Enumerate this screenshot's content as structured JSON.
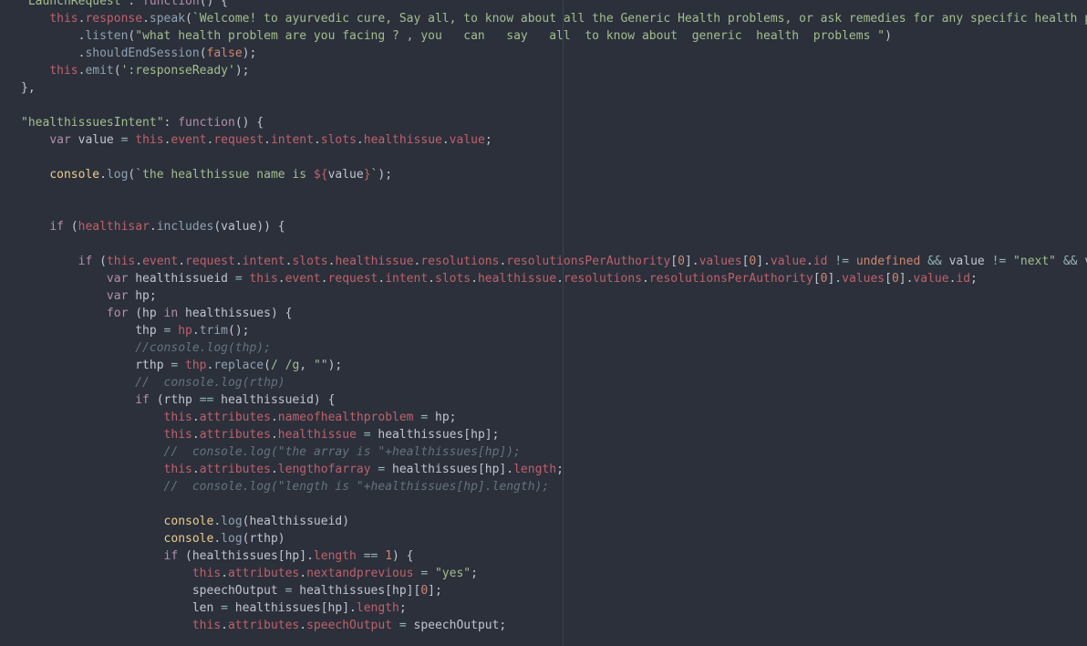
{
  "colors": {
    "background": "#2b303b",
    "plain": "#c0c5ce",
    "keyword": "#b48ead",
    "this": "#bf616a",
    "function": "#8fa1b3",
    "string": "#a3be8c",
    "number": "#d08770",
    "comment": "#65737e",
    "object": "#ebcb8b",
    "operator": "#96b5b4"
  },
  "code_lines": [
    [
      [
        "st",
        "\"LaunchRequest\""
      ],
      [
        "pl",
        ": "
      ],
      [
        "kw",
        "function"
      ],
      [
        "pl",
        "() {"
      ]
    ],
    [
      [
        "pl",
        "    "
      ],
      [
        "th",
        "this"
      ],
      [
        "pl",
        "."
      ],
      [
        "th",
        "response"
      ],
      [
        "pl",
        "."
      ],
      [
        "fn",
        "speak"
      ],
      [
        "pl",
        "("
      ],
      [
        "st",
        "`Welcome! to ayurvedic cure, Say all, to know about all the Generic Health problems, or ask remedies for any specific health p"
      ]
    ],
    [
      [
        "pl",
        "        ."
      ],
      [
        "fn",
        "listen"
      ],
      [
        "pl",
        "("
      ],
      [
        "st",
        "\"what health problem are you facing ? , you   can   say   all  to know about  generic  health  problems \""
      ],
      [
        "pl",
        ")"
      ]
    ],
    [
      [
        "pl",
        "        ."
      ],
      [
        "fn",
        "shouldEndSession"
      ],
      [
        "pl",
        "("
      ],
      [
        "nm",
        "false"
      ],
      [
        "pl",
        ");"
      ]
    ],
    [
      [
        "pl",
        "    "
      ],
      [
        "th",
        "this"
      ],
      [
        "pl",
        "."
      ],
      [
        "fn",
        "emit"
      ],
      [
        "pl",
        "("
      ],
      [
        "st",
        "':responseReady'"
      ],
      [
        "pl",
        ");"
      ]
    ],
    [
      [
        "pl",
        "},"
      ]
    ],
    [],
    [
      [
        "st",
        "\"healthissuesIntent\""
      ],
      [
        "pl",
        ": "
      ],
      [
        "kw",
        "function"
      ],
      [
        "pl",
        "() {"
      ]
    ],
    [
      [
        "pl",
        "    "
      ],
      [
        "kw",
        "var"
      ],
      [
        "pl",
        " value "
      ],
      [
        "op",
        "="
      ],
      [
        "pl",
        " "
      ],
      [
        "th",
        "this"
      ],
      [
        "pl",
        "."
      ],
      [
        "th",
        "event"
      ],
      [
        "pl",
        "."
      ],
      [
        "th",
        "request"
      ],
      [
        "pl",
        "."
      ],
      [
        "th",
        "intent"
      ],
      [
        "pl",
        "."
      ],
      [
        "th",
        "slots"
      ],
      [
        "pl",
        "."
      ],
      [
        "th",
        "healthissue"
      ],
      [
        "pl",
        "."
      ],
      [
        "th",
        "value"
      ],
      [
        "pl",
        ";"
      ]
    ],
    [],
    [
      [
        "pl",
        "    "
      ],
      [
        "ob",
        "console"
      ],
      [
        "pl",
        "."
      ],
      [
        "fn",
        "log"
      ],
      [
        "pl",
        "("
      ],
      [
        "st",
        "`the healthissue name is "
      ],
      [
        "th",
        "${"
      ],
      [
        "pl",
        "value"
      ],
      [
        "th",
        "}"
      ],
      [
        "st",
        "`"
      ],
      [
        "pl",
        ");"
      ]
    ],
    [],
    [],
    [
      [
        "pl",
        "    "
      ],
      [
        "kw",
        "if"
      ],
      [
        "pl",
        " ("
      ],
      [
        "th",
        "healthisar"
      ],
      [
        "pl",
        "."
      ],
      [
        "fn",
        "includes"
      ],
      [
        "pl",
        "(value)) {"
      ]
    ],
    [],
    [
      [
        "pl",
        "        "
      ],
      [
        "kw",
        "if"
      ],
      [
        "pl",
        " ("
      ],
      [
        "th",
        "this"
      ],
      [
        "pl",
        "."
      ],
      [
        "th",
        "event"
      ],
      [
        "pl",
        "."
      ],
      [
        "th",
        "request"
      ],
      [
        "pl",
        "."
      ],
      [
        "th",
        "intent"
      ],
      [
        "pl",
        "."
      ],
      [
        "th",
        "slots"
      ],
      [
        "pl",
        "."
      ],
      [
        "th",
        "healthissue"
      ],
      [
        "pl",
        "."
      ],
      [
        "th",
        "resolutions"
      ],
      [
        "pl",
        "."
      ],
      [
        "th",
        "resolutionsPerAuthority"
      ],
      [
        "pl",
        "["
      ],
      [
        "nm",
        "0"
      ],
      [
        "pl",
        "]."
      ],
      [
        "th",
        "values"
      ],
      [
        "pl",
        "["
      ],
      [
        "nm",
        "0"
      ],
      [
        "pl",
        "]."
      ],
      [
        "th",
        "value"
      ],
      [
        "pl",
        "."
      ],
      [
        "th",
        "id"
      ],
      [
        "pl",
        " "
      ],
      [
        "op",
        "!="
      ],
      [
        "pl",
        " "
      ],
      [
        "nm",
        "undefined"
      ],
      [
        "pl",
        " "
      ],
      [
        "op",
        "&&"
      ],
      [
        "pl",
        " value "
      ],
      [
        "op",
        "!="
      ],
      [
        "pl",
        " "
      ],
      [
        "st",
        "\"next\""
      ],
      [
        "pl",
        " "
      ],
      [
        "op",
        "&&"
      ],
      [
        "pl",
        " v"
      ]
    ],
    [
      [
        "pl",
        "            "
      ],
      [
        "kw",
        "var"
      ],
      [
        "pl",
        " healthissueid "
      ],
      [
        "op",
        "="
      ],
      [
        "pl",
        " "
      ],
      [
        "th",
        "this"
      ],
      [
        "pl",
        "."
      ],
      [
        "th",
        "event"
      ],
      [
        "pl",
        "."
      ],
      [
        "th",
        "request"
      ],
      [
        "pl",
        "."
      ],
      [
        "th",
        "intent"
      ],
      [
        "pl",
        "."
      ],
      [
        "th",
        "slots"
      ],
      [
        "pl",
        "."
      ],
      [
        "th",
        "healthissue"
      ],
      [
        "pl",
        "."
      ],
      [
        "th",
        "resolutions"
      ],
      [
        "pl",
        "."
      ],
      [
        "th",
        "resolutionsPerAuthority"
      ],
      [
        "pl",
        "["
      ],
      [
        "nm",
        "0"
      ],
      [
        "pl",
        "]."
      ],
      [
        "th",
        "values"
      ],
      [
        "pl",
        "["
      ],
      [
        "nm",
        "0"
      ],
      [
        "pl",
        "]."
      ],
      [
        "th",
        "value"
      ],
      [
        "pl",
        "."
      ],
      [
        "th",
        "id"
      ],
      [
        "pl",
        ";"
      ]
    ],
    [
      [
        "pl",
        "            "
      ],
      [
        "kw",
        "var"
      ],
      [
        "pl",
        " hp;"
      ]
    ],
    [
      [
        "pl",
        "            "
      ],
      [
        "kw",
        "for"
      ],
      [
        "pl",
        " (hp "
      ],
      [
        "kw",
        "in"
      ],
      [
        "pl",
        " healthissues) {"
      ]
    ],
    [
      [
        "pl",
        "                thp "
      ],
      [
        "op",
        "="
      ],
      [
        "pl",
        " "
      ],
      [
        "th",
        "hp"
      ],
      [
        "pl",
        "."
      ],
      [
        "fn",
        "trim"
      ],
      [
        "pl",
        "();"
      ]
    ],
    [
      [
        "pl",
        "                "
      ],
      [
        "cm",
        "//console.log(thp);"
      ]
    ],
    [
      [
        "pl",
        "                rthp "
      ],
      [
        "op",
        "="
      ],
      [
        "pl",
        " "
      ],
      [
        "th",
        "thp"
      ],
      [
        "pl",
        "."
      ],
      [
        "fn",
        "replace"
      ],
      [
        "pl",
        "("
      ],
      [
        "st",
        "/ /g"
      ],
      [
        "pl",
        ", "
      ],
      [
        "st",
        "\"\""
      ],
      [
        "pl",
        ");"
      ]
    ],
    [
      [
        "pl",
        "                "
      ],
      [
        "cm",
        "//  console.log(rthp)"
      ]
    ],
    [
      [
        "pl",
        "                "
      ],
      [
        "kw",
        "if"
      ],
      [
        "pl",
        " (rthp "
      ],
      [
        "op",
        "=="
      ],
      [
        "pl",
        " healthissueid) {"
      ]
    ],
    [
      [
        "pl",
        "                    "
      ],
      [
        "th",
        "this"
      ],
      [
        "pl",
        "."
      ],
      [
        "th",
        "attributes"
      ],
      [
        "pl",
        "."
      ],
      [
        "th",
        "nameofhealthproblem"
      ],
      [
        "pl",
        " "
      ],
      [
        "op",
        "="
      ],
      [
        "pl",
        " hp;"
      ]
    ],
    [
      [
        "pl",
        "                    "
      ],
      [
        "th",
        "this"
      ],
      [
        "pl",
        "."
      ],
      [
        "th",
        "attributes"
      ],
      [
        "pl",
        "."
      ],
      [
        "th",
        "healthissue"
      ],
      [
        "pl",
        " "
      ],
      [
        "op",
        "="
      ],
      [
        "pl",
        " healthissues[hp];"
      ]
    ],
    [
      [
        "pl",
        "                    "
      ],
      [
        "cm",
        "//  console.log(\"the array is \"+healthissues[hp]);"
      ]
    ],
    [
      [
        "pl",
        "                    "
      ],
      [
        "th",
        "this"
      ],
      [
        "pl",
        "."
      ],
      [
        "th",
        "attributes"
      ],
      [
        "pl",
        "."
      ],
      [
        "th",
        "lengthofarray"
      ],
      [
        "pl",
        " "
      ],
      [
        "op",
        "="
      ],
      [
        "pl",
        " healthissues[hp]."
      ],
      [
        "th",
        "length"
      ],
      [
        "pl",
        ";"
      ]
    ],
    [
      [
        "pl",
        "                    "
      ],
      [
        "cm",
        "//  console.log(\"length is \"+healthissues[hp].length);"
      ]
    ],
    [],
    [
      [
        "pl",
        "                    "
      ],
      [
        "ob",
        "console"
      ],
      [
        "pl",
        "."
      ],
      [
        "fn",
        "log"
      ],
      [
        "pl",
        "(healthissueid)"
      ]
    ],
    [
      [
        "pl",
        "                    "
      ],
      [
        "ob",
        "console"
      ],
      [
        "pl",
        "."
      ],
      [
        "fn",
        "log"
      ],
      [
        "pl",
        "(rthp)"
      ]
    ],
    [
      [
        "pl",
        "                    "
      ],
      [
        "kw",
        "if"
      ],
      [
        "pl",
        " (healthissues[hp]."
      ],
      [
        "th",
        "length"
      ],
      [
        "pl",
        " "
      ],
      [
        "op",
        "=="
      ],
      [
        "pl",
        " "
      ],
      [
        "nm",
        "1"
      ],
      [
        "pl",
        ") {"
      ]
    ],
    [
      [
        "pl",
        "                        "
      ],
      [
        "th",
        "this"
      ],
      [
        "pl",
        "."
      ],
      [
        "th",
        "attributes"
      ],
      [
        "pl",
        "."
      ],
      [
        "th",
        "nextandprevious"
      ],
      [
        "pl",
        " "
      ],
      [
        "op",
        "="
      ],
      [
        "pl",
        " "
      ],
      [
        "st",
        "\"yes\""
      ],
      [
        "pl",
        ";"
      ]
    ],
    [
      [
        "pl",
        "                        speechOutput "
      ],
      [
        "op",
        "="
      ],
      [
        "pl",
        " healthissues[hp]["
      ],
      [
        "nm",
        "0"
      ],
      [
        "pl",
        "];"
      ]
    ],
    [
      [
        "pl",
        "                        len "
      ],
      [
        "op",
        "="
      ],
      [
        "pl",
        " healthissues[hp]."
      ],
      [
        "th",
        "length"
      ],
      [
        "pl",
        ";"
      ]
    ],
    [
      [
        "pl",
        "                        "
      ],
      [
        "th",
        "this"
      ],
      [
        "pl",
        "."
      ],
      [
        "th",
        "attributes"
      ],
      [
        "pl",
        "."
      ],
      [
        "th",
        "speechOutput"
      ],
      [
        "pl",
        " "
      ],
      [
        "op",
        "="
      ],
      [
        "pl",
        " speechOutput;"
      ]
    ]
  ]
}
